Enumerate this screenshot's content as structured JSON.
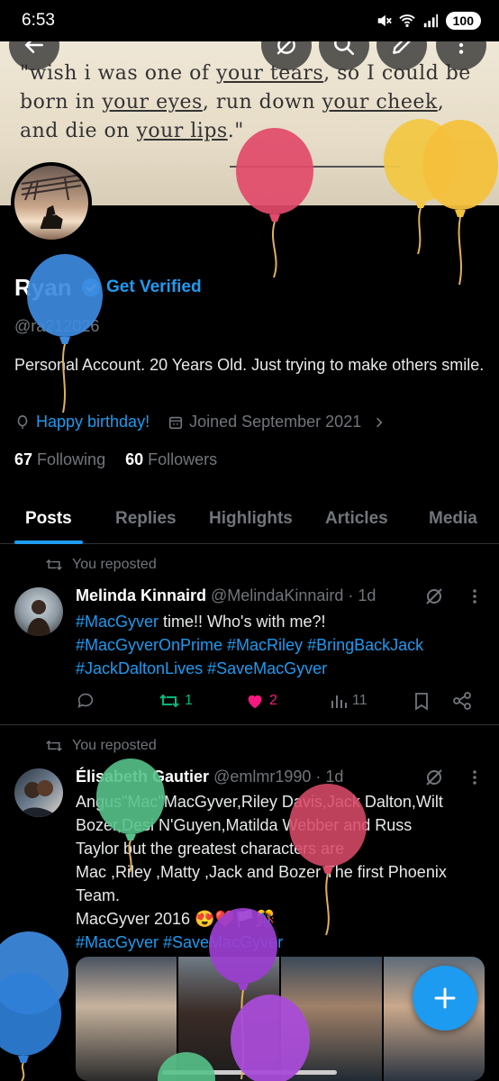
{
  "status": {
    "time": "6:53",
    "battery": "100"
  },
  "banner": {
    "quote_parts": [
      "\"wish i was one of ",
      "your tears",
      ", so I could be born in ",
      "your eyes",
      ", run down ",
      "your cheek",
      ", and die on ",
      "your lips",
      ".\""
    ]
  },
  "profile": {
    "name": "Ryan",
    "get_verified": "Get Verified",
    "handle": "@ra212026",
    "bio": "Personal Account. 20 Years Old. Just trying to make others smile.",
    "birthday": "Happy birthday!",
    "joined": "Joined September 2021",
    "following_count": "67",
    "following_label": "Following",
    "followers_count": "60",
    "followers_label": "Followers"
  },
  "tabs": [
    "Posts",
    "Replies",
    "Highlights",
    "Articles",
    "Media"
  ],
  "posts": [
    {
      "repost_label": "You reposted",
      "name": "Melinda Kinnaird",
      "handle_time": "@MelindaKinnaird · 1d",
      "text_tag1": "#MacGyver",
      "text_rest1": " time!! Who's with me?!",
      "tags_line2": "#MacGyverOnPrime #MacRiley #BringBackJack",
      "tags_line3": "#JackDaltonLives #SaveMacGyver",
      "reposts": "1",
      "likes": "2",
      "views": "11"
    },
    {
      "repost_label": "You reposted",
      "name": "Élisabeth Gautier",
      "handle_time": "@emlmr1990 · 1d",
      "line1": "Angus\"Mac\"MacGyver,Riley Davis,Jack Dalton,Wilt",
      "line2": "Bozer,Desi N'Guyen,Matilda Webber and Russ",
      "line3": "Taylor but the greatest  characters are",
      "line4": "Mac ,Riley ,Matty ,Jack and Bozer The first Phoenix",
      "line5": "Team.",
      "line6": "MacGyver 2016 😍❤️🏳️🎊",
      "tags": "#MacGyver #SaveMacGyver"
    }
  ],
  "colors": {
    "accent": "#1d9bf0",
    "like": "#f91880",
    "repost": "#00ba7c"
  }
}
